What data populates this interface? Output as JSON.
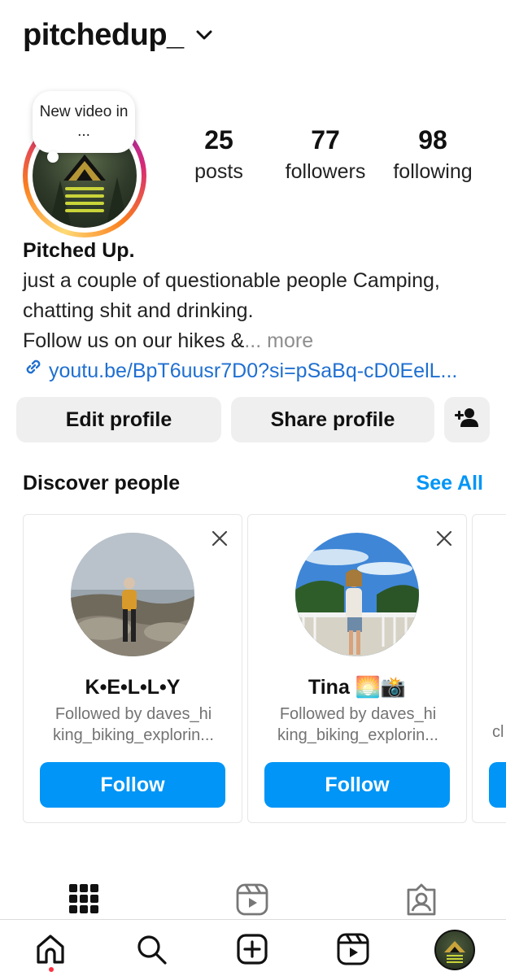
{
  "profile": {
    "username": "pitchedup_",
    "story_bubble": "New video in ...",
    "stats": [
      {
        "num": "25",
        "label": "posts"
      },
      {
        "num": "77",
        "label": "followers"
      },
      {
        "num": "98",
        "label": "following"
      }
    ],
    "name": "Pitched Up.",
    "bio_line1": "just a couple of questionable people Camping,",
    "bio_line2": "chatting shit and drinking.",
    "bio_line3": "Follow us on our hikes &",
    "bio_more": "... more",
    "link": "youtu.be/BpT6uusr7D0?si=pSaBq-cD0EelL..."
  },
  "buttons": {
    "edit": "Edit profile",
    "share": "Share profile"
  },
  "discover": {
    "title": "Discover people",
    "see_all": "See All",
    "cards": [
      {
        "name": "K•E•L•L•Y",
        "sub": "Followed by daves_hi king_biking_explorin...",
        "follow": "Follow"
      },
      {
        "name": "Tina 🌅📸",
        "sub": "Followed by daves_hi king_biking_explorin...",
        "follow": "Follow"
      }
    ],
    "peek_text": "cl"
  },
  "colors": {
    "accent": "#0095f6",
    "link": "#1f6fd1",
    "button_bg": "#efefef",
    "notification_dot": "#ff3040"
  }
}
